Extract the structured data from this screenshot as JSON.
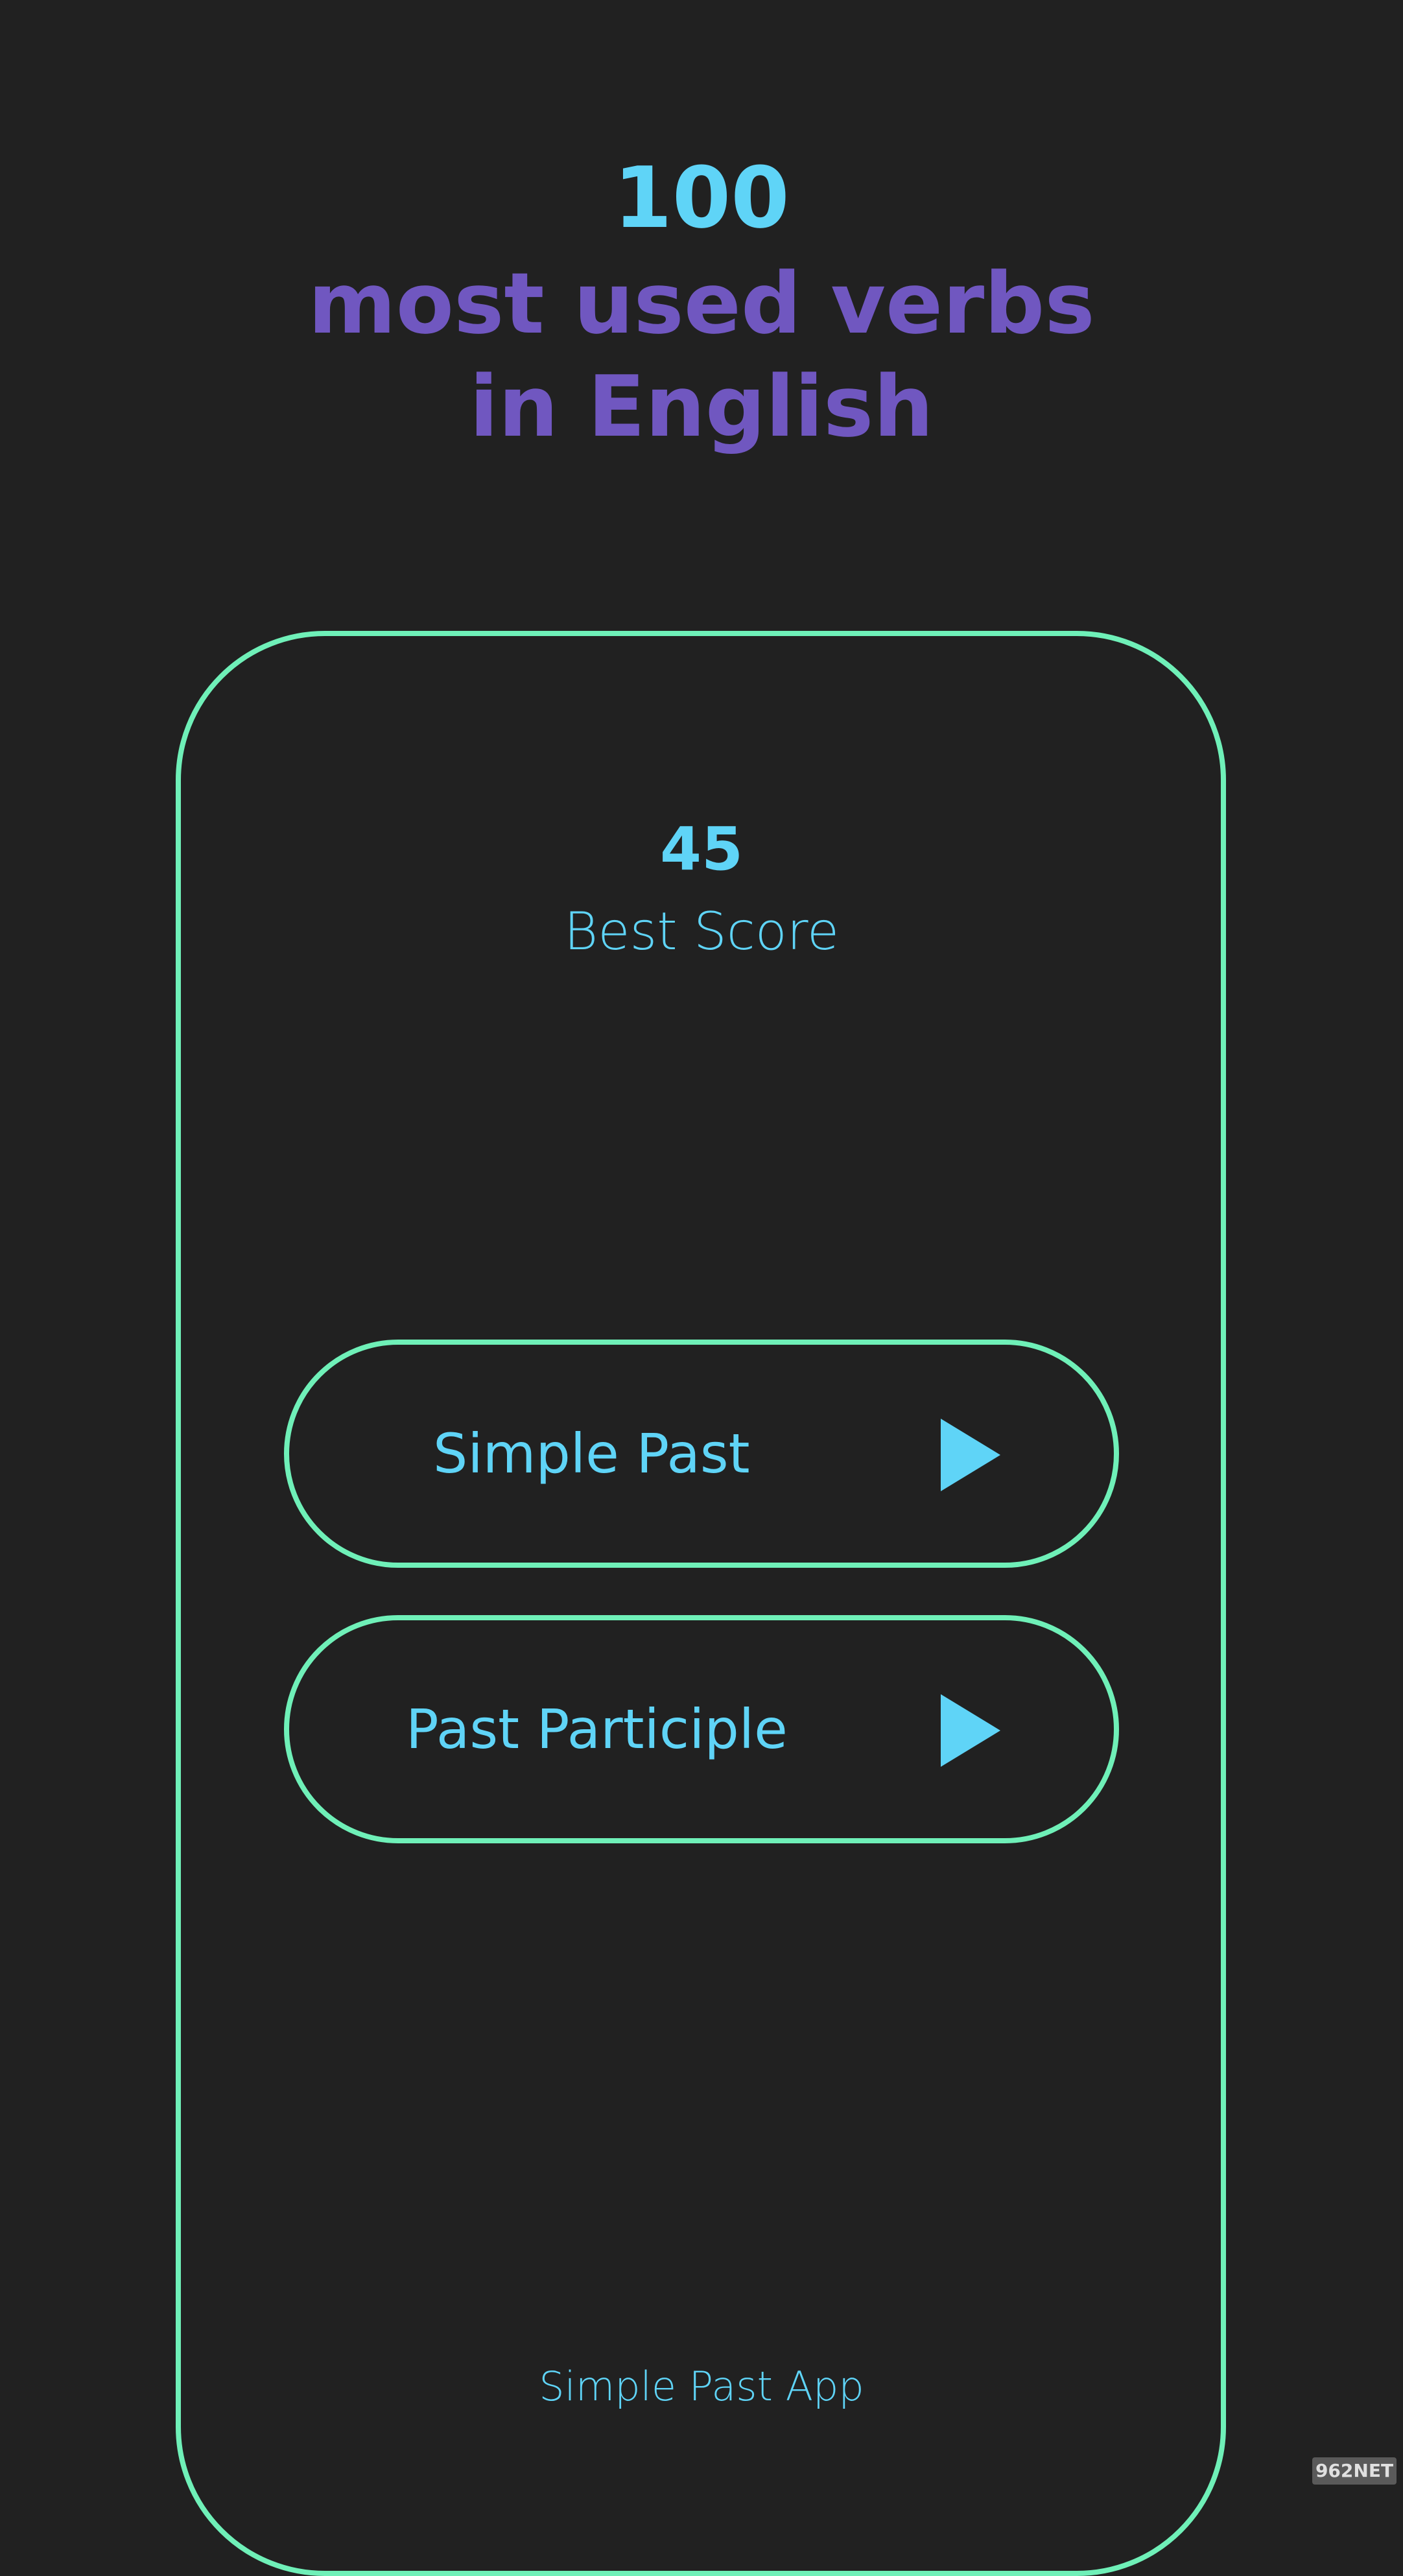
{
  "header": {
    "number": "100",
    "line1": "most used verbs",
    "line2": "in English"
  },
  "score": {
    "value": "45",
    "label": "Best Score"
  },
  "modes": [
    {
      "label": "Simple Past",
      "icon": "play-icon"
    },
    {
      "label": "Past Participle",
      "icon": "play-icon"
    }
  ],
  "footer": {
    "label": "Simple Past App"
  },
  "watermark": {
    "text": "962NET"
  },
  "colors": {
    "background": "#212121",
    "accent_cyan": "#5fd4f7",
    "accent_purple": "#7057c0",
    "outline_green": "#6ff0b8"
  }
}
